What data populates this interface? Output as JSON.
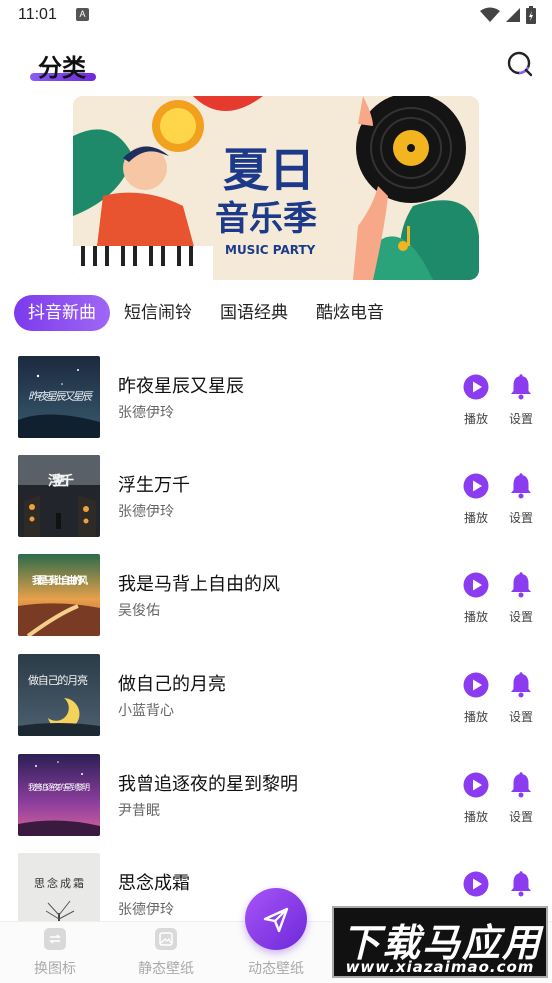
{
  "status_bar": {
    "time": "11:01",
    "notification_glyph": "A"
  },
  "header": {
    "title": "分类"
  },
  "banner": {
    "title_line1": "夏日",
    "title_line2": "音乐季",
    "subtitle": "MUSIC PARTY"
  },
  "tabs": [
    {
      "label": "抖音新曲",
      "active": true
    },
    {
      "label": "短信闹铃",
      "active": false
    },
    {
      "label": "国语经典",
      "active": false
    },
    {
      "label": "酷炫电音",
      "active": false
    }
  ],
  "actions": {
    "play_label": "播放",
    "set_label": "设置"
  },
  "songs": [
    {
      "title": "昨夜星辰又星辰",
      "artist": "张德伊玲",
      "cover_text": "昨夜星辰又星辰"
    },
    {
      "title": "浮生万千",
      "artist": "张德伊玲",
      "cover_text": "浮生万千"
    },
    {
      "title": "我是马背上自由的风",
      "artist": "吴俊佑",
      "cover_text": "我是马背上自由的风"
    },
    {
      "title": "做自己的月亮",
      "artist": "小蓝背心",
      "cover_text": "做自己的月亮"
    },
    {
      "title": "我曾追逐夜的星到黎明",
      "artist": "尹昔眠",
      "cover_text": "我曾追逐夜的星到黎明"
    },
    {
      "title": "思念成霜",
      "artist": "张德伊玲",
      "cover_text": "思念成霜"
    }
  ],
  "bottom_nav": [
    {
      "label": "换图标",
      "icon": "swap-icon"
    },
    {
      "label": "静态壁纸",
      "icon": "image-icon"
    },
    {
      "label": "动态壁纸",
      "icon": "send-icon"
    }
  ],
  "watermark": {
    "main": "下载马应用",
    "sub": "www.xiazaimao.com"
  },
  "colors": {
    "accent": "#7c3aed",
    "accent_light": "#9f67f5"
  }
}
